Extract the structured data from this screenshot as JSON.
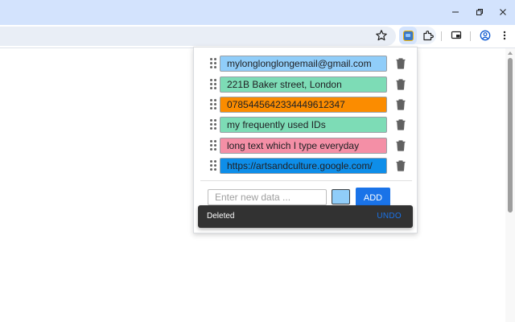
{
  "browser": {
    "window_buttons": [
      {
        "name": "minimize-button",
        "icon": "minimize-icon"
      },
      {
        "name": "restore-button",
        "icon": "restore-icon"
      },
      {
        "name": "close-button",
        "icon": "close-icon"
      }
    ],
    "toolbar_icons": [
      "star-icon",
      "extension-active-icon",
      "puzzle-icon",
      "cast-icon",
      "profile-icon",
      "kebab-menu-icon"
    ]
  },
  "popup": {
    "items": [
      {
        "text": "mylonglonglongemail@gmail.com",
        "color": "#90cdf9"
      },
      {
        "text": "221B Baker street, London",
        "color": "#7ddcb6"
      },
      {
        "text": "0785445642334449612347",
        "color": "#fb8c00"
      },
      {
        "text": "my frequently used IDs",
        "color": "#7ddcb6"
      },
      {
        "text": "long text which I type everyday",
        "color": "#f48fa6"
      },
      {
        "text": "https://artsandculture.google.com/",
        "color": "#0e8ee9"
      }
    ],
    "new_data": {
      "placeholder": "Enter new data ...",
      "value": "",
      "color": "#90cdf9"
    },
    "add_label": "ADD"
  },
  "snackbar": {
    "message": "Deleted",
    "action": "UNDO"
  }
}
